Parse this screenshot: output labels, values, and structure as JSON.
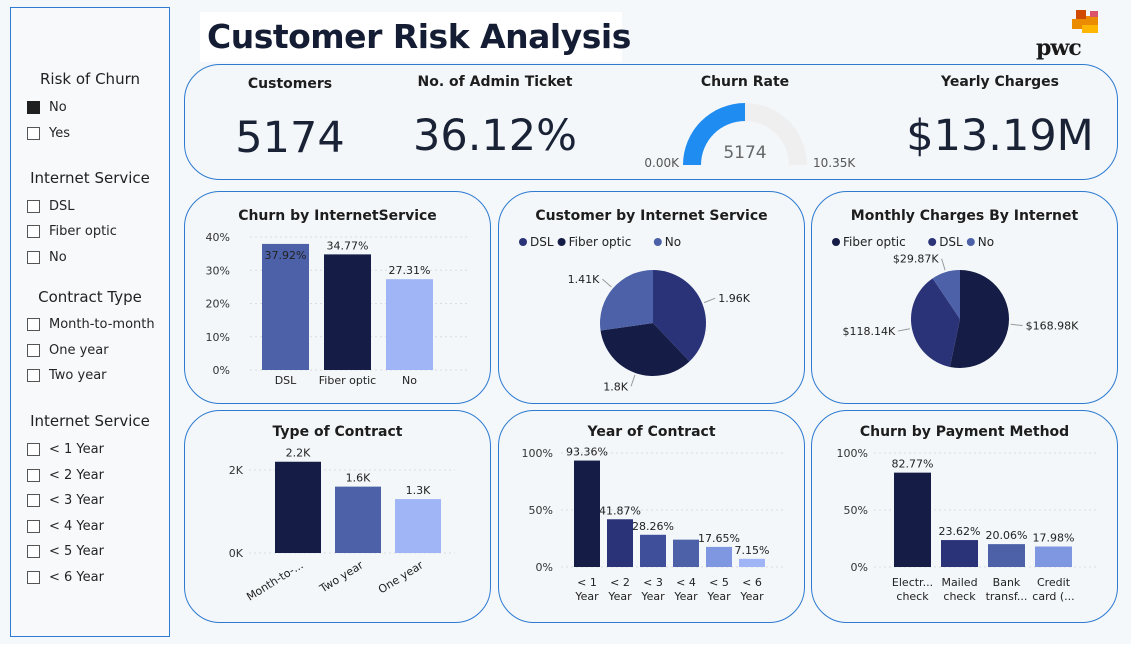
{
  "title": "Customer Risk Analysis",
  "logo": {
    "text": "pwc",
    "colors": [
      "#d04a02",
      "#eb8c00",
      "#ffb600",
      "#db536a"
    ]
  },
  "slicers": [
    {
      "title": "Risk of Churn",
      "items": [
        {
          "label": "No",
          "checked": true
        },
        {
          "label": "Yes",
          "checked": false
        }
      ]
    },
    {
      "title": "Internet Service",
      "items": [
        {
          "label": "DSL",
          "checked": false
        },
        {
          "label": "Fiber optic",
          "checked": false
        },
        {
          "label": "No",
          "checked": false
        }
      ]
    },
    {
      "title": "Contract Type",
      "items": [
        {
          "label": "Month-to-month",
          "checked": false
        },
        {
          "label": "One year",
          "checked": false
        },
        {
          "label": "Two year",
          "checked": false
        }
      ]
    },
    {
      "title": "Internet Service",
      "items": [
        {
          "label": "< 1 Year",
          "checked": false
        },
        {
          "label": "< 2 Year",
          "checked": false
        },
        {
          "label": "< 3 Year",
          "checked": false
        },
        {
          "label": "< 4 Year",
          "checked": false
        },
        {
          "label": "< 5 Year",
          "checked": false
        },
        {
          "label": "< 6 Year",
          "checked": false
        }
      ]
    }
  ],
  "kpis": {
    "customers": {
      "label": "Customers",
      "value": "5174"
    },
    "admin_ticket": {
      "label": "No. of Admin Ticket",
      "value": "36.12%"
    },
    "churn_rate": {
      "label": "Churn Rate",
      "value": "5174",
      "min": "0.00K",
      "max": "10.35K",
      "fraction": 0.5
    },
    "yearly_charges": {
      "label": "Yearly Charges",
      "value": "$13.19M"
    }
  },
  "colors": {
    "navy": "#151c45",
    "blue": "#4c61a8",
    "mid": "#2a3278",
    "light": "#9fb5f6",
    "gauge": "#1f8cf1",
    "gauge_bg": "#efefef"
  },
  "chart_data": [
    {
      "id": "churn-by-internet",
      "type": "bar",
      "title": "Churn by InternetService",
      "categories": [
        "DSL",
        "Fiber optic",
        "No"
      ],
      "values": [
        37.92,
        34.77,
        27.31
      ],
      "labels": [
        "37.92%",
        "34.77%",
        "27.31%"
      ],
      "ticks": [
        "0%",
        "10%",
        "20%",
        "30%",
        "40%"
      ],
      "ylim": [
        0,
        40
      ],
      "bar_colors": [
        "#4c61a8",
        "#151c45",
        "#9fb5f6"
      ]
    },
    {
      "id": "customer-by-internet",
      "type": "pie",
      "title": "Customer by Internet Service",
      "legend": [
        "DSL",
        "Fiber optic",
        "No"
      ],
      "legend_colors": [
        "#2a3278",
        "#151c45",
        "#4c61a8"
      ],
      "slices": [
        {
          "name": "DSL",
          "value": 1.96,
          "label": "1.96K",
          "color": "#2a3278"
        },
        {
          "name": "Fiber optic",
          "value": 1.8,
          "label": "1.8K",
          "color": "#151c45"
        },
        {
          "name": "No",
          "value": 1.41,
          "label": "1.41K",
          "color": "#4c61a8"
        }
      ]
    },
    {
      "id": "monthly-charges",
      "type": "pie",
      "title": "Monthly Charges By Internet",
      "legend": [
        "Fiber optic",
        "DSL",
        "No"
      ],
      "legend_colors": [
        "#151c45",
        "#2a3278",
        "#4c61a8"
      ],
      "slices": [
        {
          "name": "Fiber optic",
          "value": 168.98,
          "label": "$168.98K",
          "color": "#151c45"
        },
        {
          "name": "DSL",
          "value": 118.14,
          "label": "$118.14K",
          "color": "#2a3278"
        },
        {
          "name": "No",
          "value": 29.87,
          "label": "$29.87K",
          "color": "#4c61a8"
        }
      ]
    },
    {
      "id": "type-of-contract",
      "type": "bar",
      "title": "Type of Contract",
      "categories": [
        "Month-to-...",
        "Two year",
        "One year"
      ],
      "values": [
        2.2,
        1.6,
        1.3
      ],
      "labels": [
        "2.2K",
        "1.6K",
        "1.3K"
      ],
      "ticks": [
        "0K",
        "2K"
      ],
      "ylim": [
        0,
        2.7
      ],
      "bar_colors": [
        "#151c45",
        "#4c61a8",
        "#9fb5f6"
      ]
    },
    {
      "id": "year-of-contract",
      "type": "bar",
      "title": "Year of Contract",
      "categories": [
        [
          "< 1",
          "Year"
        ],
        [
          "< 2",
          "Year"
        ],
        [
          "< 3",
          "Year"
        ],
        [
          "< 4",
          "Year"
        ],
        [
          "< 5",
          "Year"
        ],
        [
          "< 6",
          "Year"
        ]
      ],
      "values": [
        93.36,
        41.87,
        28.26,
        24.0,
        17.65,
        7.15
      ],
      "labels": [
        "93.36%",
        "41.87%",
        "28.26%",
        "",
        "17.65%",
        "7.15%"
      ],
      "ticks": [
        "0%",
        "50%",
        "100%"
      ],
      "ylim": [
        0,
        100
      ],
      "bar_colors": [
        "#151c45",
        "#2a3278",
        "#3f4f99",
        "#4c61a8",
        "#7f96e0",
        "#9fb5f6"
      ]
    },
    {
      "id": "churn-by-payment",
      "type": "bar",
      "title": "Churn by Payment Method",
      "categories": [
        [
          "Electr...",
          "check"
        ],
        [
          "Mailed",
          "check"
        ],
        [
          "Bank",
          "transf..."
        ],
        [
          "Credit",
          "card (..."
        ]
      ],
      "values": [
        82.77,
        23.62,
        20.06,
        17.98
      ],
      "labels": [
        "82.77%",
        "23.62%",
        "20.06%",
        "17.98%"
      ],
      "ticks": [
        "0%",
        "50%",
        "100%"
      ],
      "ylim": [
        0,
        100
      ],
      "bar_colors": [
        "#151c45",
        "#2a3278",
        "#4c61a8",
        "#7f96e0"
      ]
    }
  ]
}
